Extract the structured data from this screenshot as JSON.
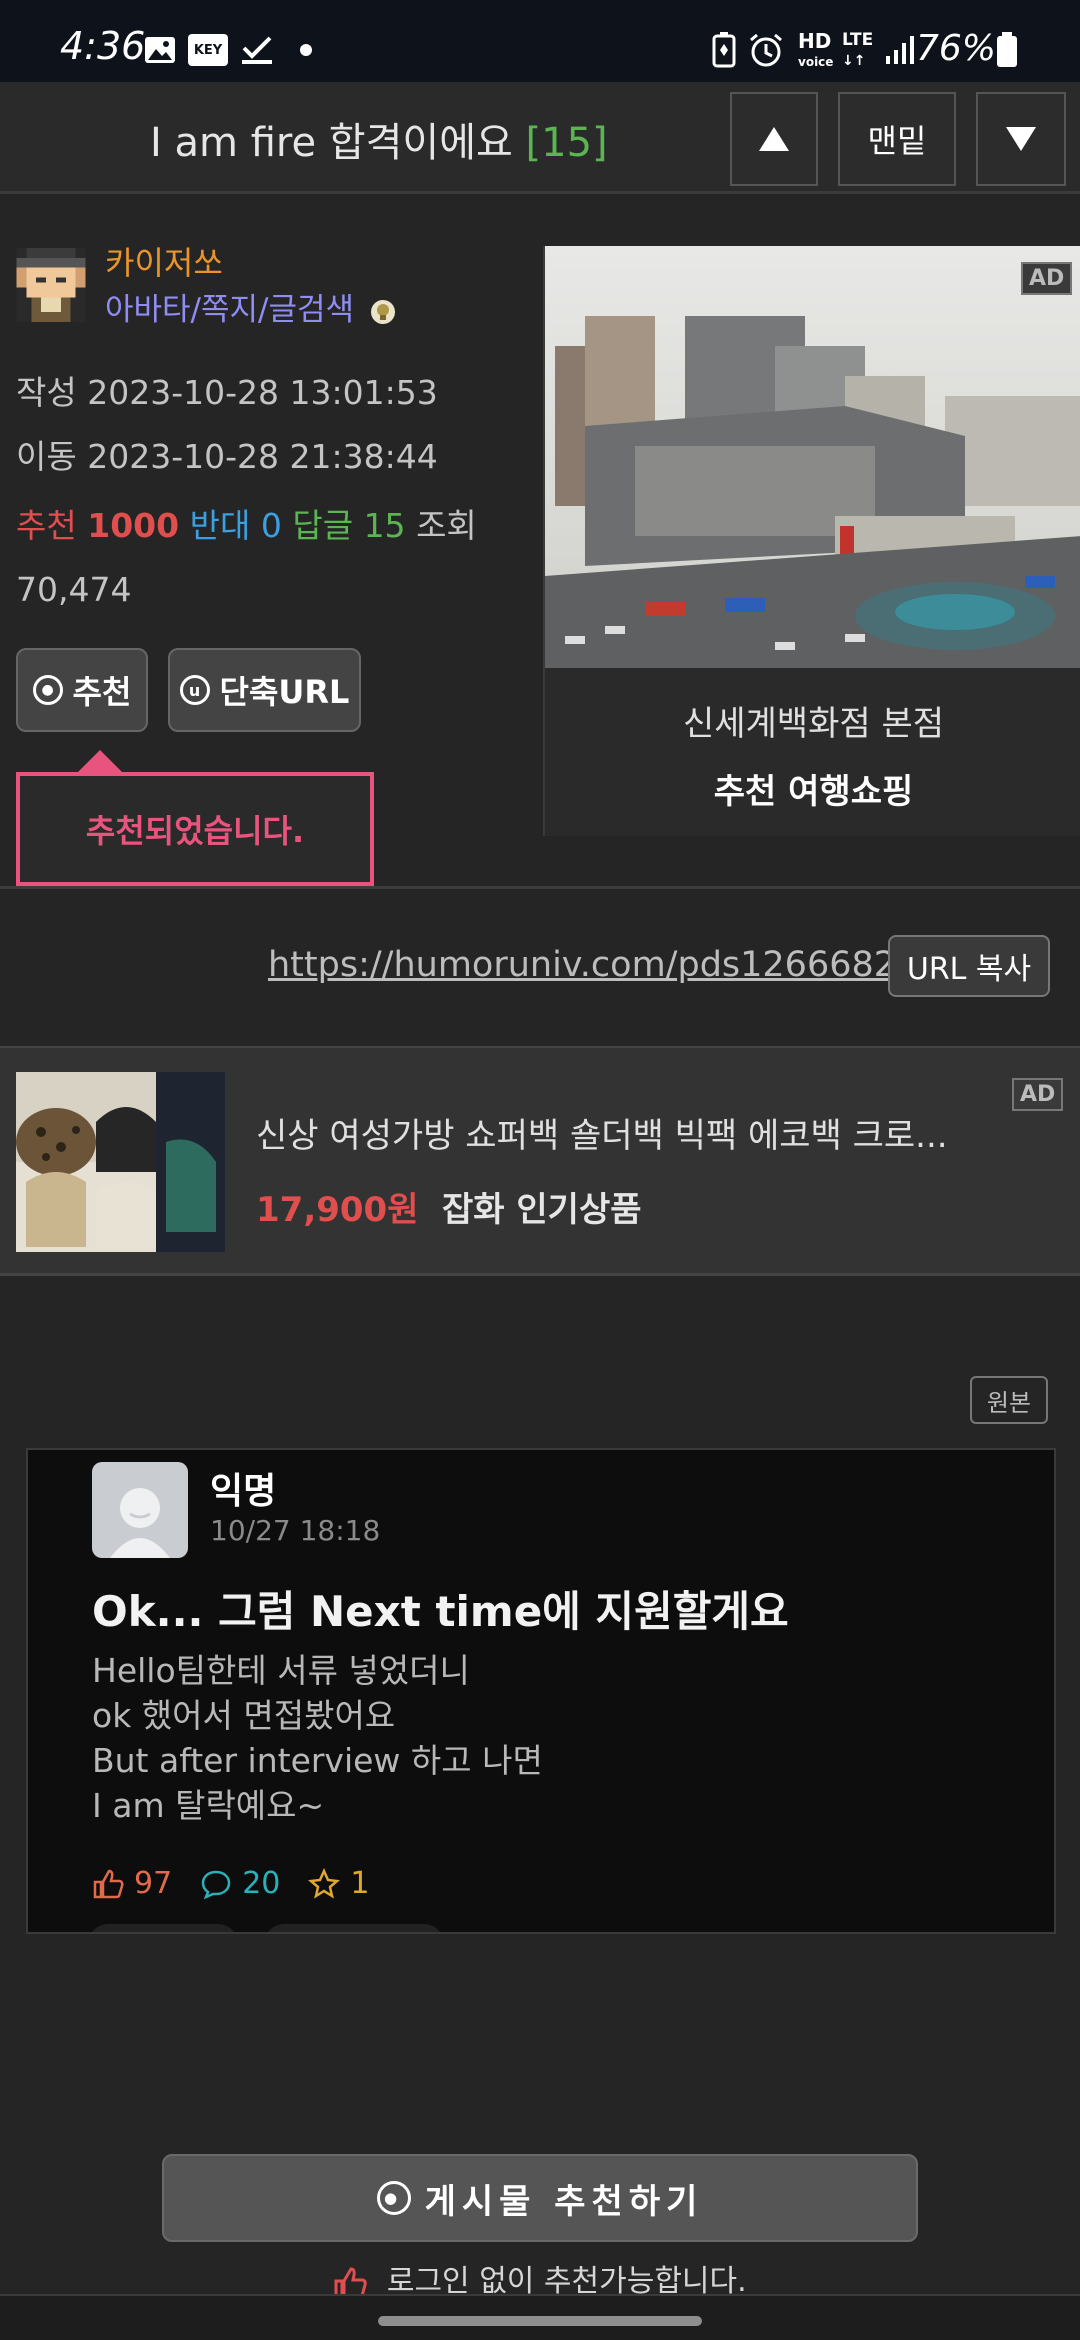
{
  "status_bar": {
    "time": "4:36",
    "key_badge": "KEY",
    "hd_label": "HD",
    "voice_label": "voice",
    "lte_label": "LTE",
    "battery": "76%"
  },
  "title_bar": {
    "title": "I am fire 합격이에요",
    "count": "[15]",
    "bottom_label": "맨밑"
  },
  "author": {
    "name": "카이저쏘",
    "links": "아바타/쪽지/글검색"
  },
  "meta": {
    "written_label": "작성",
    "written": "2023-10-28 13:01:53",
    "moved_label": "이동",
    "moved": "2023-10-28 21:38:44",
    "recommend_label": "추천",
    "recommend": "1000",
    "oppose_label": "반대",
    "oppose": "0",
    "reply_label": "답글",
    "reply": "15",
    "views_label": "조회",
    "views": "70,474"
  },
  "actions": {
    "recommend": "추천",
    "short_url": "단축URL",
    "recommended_msg": "추천되었습니다."
  },
  "ad_right": {
    "badge": "AD",
    "title": "신세계백화점 본점",
    "subtitle": "추천 여행쇼핑"
  },
  "url_row": {
    "url": "https://humoruniv.com/pds1266682",
    "copy": "URL 복사"
  },
  "product_ad": {
    "badge": "AD",
    "title": "신상 여성가방 쇼퍼백 숄더백 빅팩 에코백 크로...",
    "price": "17,900원",
    "category": "잡화 인기상품"
  },
  "embedded": {
    "original_btn": "원본",
    "user": "익명",
    "date": "10/27 18:18",
    "headline": "Ok... 그럼 Next time에 지원할게요",
    "body_lines": [
      "Hello팀한테 서류 넣었더니",
      "ok 했어서 면접봤어요",
      "But after interview 하고 나면",
      "I am 탈락예요~"
    ],
    "likes": "97",
    "comments": "20",
    "stars": "1"
  },
  "bottom": {
    "recommend_post": "게시물 추천하기",
    "login_note": "로그인 없이 추천가능합니다."
  },
  "colors": {
    "accent_green": "#5ab552",
    "recommend_red": "#e04e4e",
    "oppose_blue": "#3aa0e0",
    "author_orange": "#e9952a",
    "link_purple": "#8f8df2",
    "tooltip_pink": "#e8547d"
  }
}
